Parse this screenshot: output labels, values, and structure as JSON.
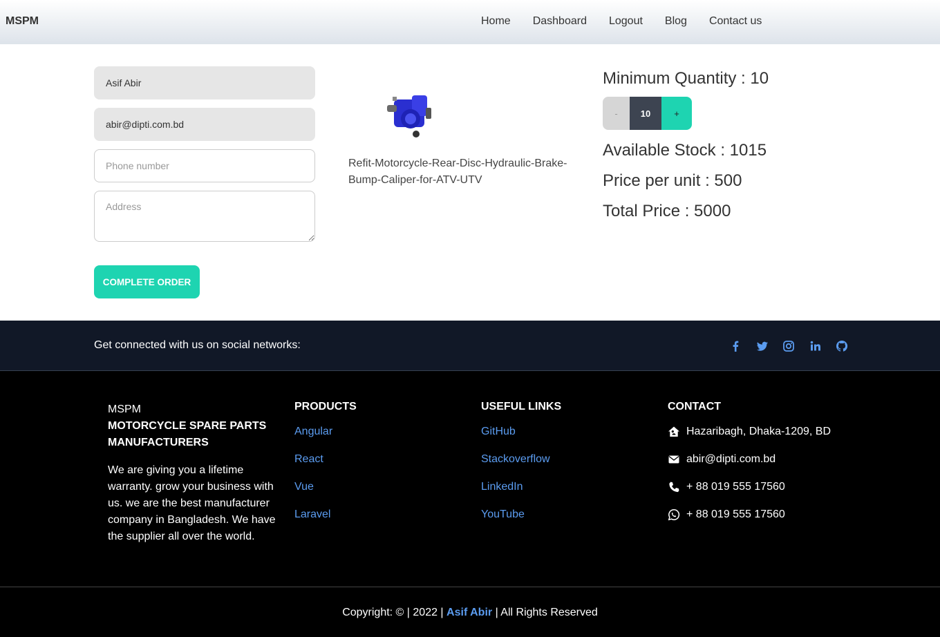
{
  "nav": {
    "brand": "MSPM",
    "links": [
      "Home",
      "Dashboard",
      "Logout",
      "Blog",
      "Contact us"
    ]
  },
  "form": {
    "name_value": "Asif Abir",
    "email_value": "abir@dipti.com.bd",
    "phone_placeholder": "Phone number",
    "address_placeholder": "Address",
    "submit_label": "COMPLETE ORDER"
  },
  "product": {
    "name": "Refit-Motorcycle-Rear-Disc-Hydraulic-Brake-Bump-Caliper-for-ATV-UTV",
    "image_icon": "brake-caliper-image"
  },
  "order": {
    "min_qty_text": "Minimum Quantity : 10",
    "minus_label": "-",
    "qty_value": "10",
    "plus_label": "+",
    "stock_text": "Available Stock : 1015",
    "price_text": "Price per unit : 500",
    "total_text": "Total Price : 5000"
  },
  "social": {
    "text": "Get connected with us on social networks:",
    "icons": [
      "facebook-icon",
      "twitter-icon",
      "instagram-icon",
      "linkedin-icon",
      "github-icon"
    ],
    "icon_color": "#5b9cf0"
  },
  "footer": {
    "brand": {
      "name": "MSPM",
      "tagline": "MOTORCYCLE SPARE PARTS MANUFACTURERS",
      "description": "We are giving you a lifetime warranty. grow your business with us. we are the best manufacturer company in Bangladesh. We have the supplier all over the world."
    },
    "products": {
      "heading": "PRODUCTS",
      "links": [
        "Angular",
        "React",
        "Vue",
        "Laravel"
      ]
    },
    "useful": {
      "heading": "USEFUL LINKS",
      "links": [
        "GitHub",
        "Stackoverflow",
        "LinkedIn",
        "YouTube"
      ]
    },
    "contact": {
      "heading": "CONTACT",
      "address": "Hazaribagh, Dhaka-1209, BD",
      "email": "abir@dipti.com.bd",
      "phone": "+ 88 019 555 17560",
      "whatsapp": "+ 88 019 555 17560"
    },
    "copyright": {
      "prefix": "Copyright: © | 2022 |",
      "author": "Asif Abir",
      "suffix": "| All Rights Reserved"
    }
  },
  "colors": {
    "accent": "#1ed4b1",
    "link": "#5b9cf0",
    "social_bar": "#111827",
    "footer": "#000000",
    "qty_value_bg": "#3d4451"
  }
}
